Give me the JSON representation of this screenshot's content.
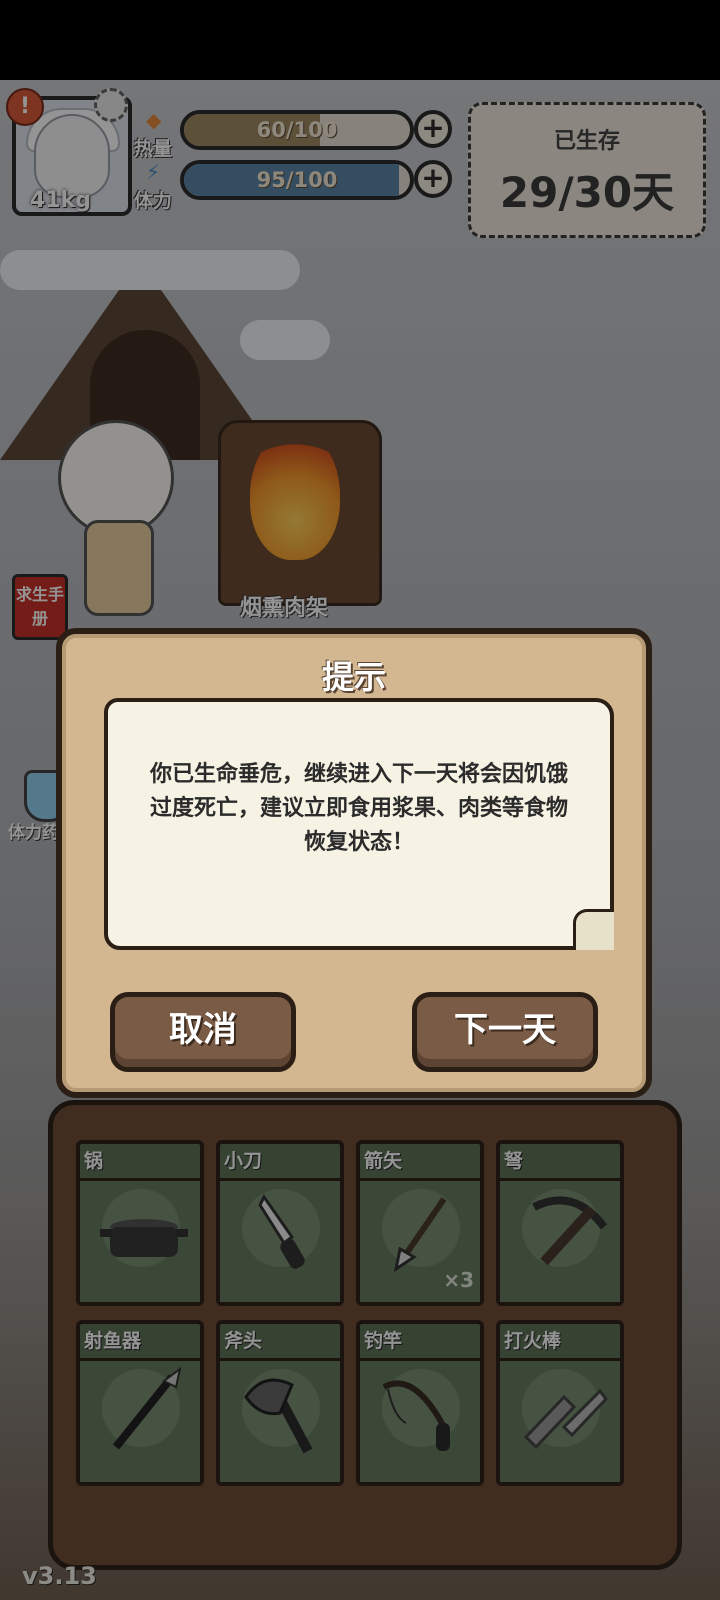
{
  "hud": {
    "weight": "41kg",
    "alert": "!",
    "heat": {
      "label": "热量",
      "value": "60/100",
      "ratio": 0.6,
      "color": "#9f8a63"
    },
    "stamina": {
      "label": "体力",
      "value": "95/100",
      "ratio": 0.95,
      "color": "#5b86a8"
    },
    "survive_label": "已生存",
    "survive_days": "29/30天"
  },
  "scene": {
    "rack_label": "烟熏肉架",
    "guide_label": "求生手册",
    "potion_label": "体力药"
  },
  "dialog": {
    "title": "提示",
    "message_lines": [
      "你已生命垂危，继续进入下一天将会因饥饿",
      "过度死亡，建议立即食用浆果、肉类等食物",
      "恢复状态！"
    ],
    "cancel_label": "取消",
    "next_label": "下一天"
  },
  "inventory": [
    {
      "name": "锅",
      "icon": "pot-icon"
    },
    {
      "name": "小刀",
      "icon": "knife-icon"
    },
    {
      "name": "箭矢",
      "icon": "arrow-icon",
      "count": "×3"
    },
    {
      "name": "弩",
      "icon": "crossbow-icon"
    },
    {
      "name": "射鱼器",
      "icon": "fish-spear-icon"
    },
    {
      "name": "斧头",
      "icon": "axe-icon"
    },
    {
      "name": "钓竿",
      "icon": "fishing-rod-icon"
    },
    {
      "name": "打火棒",
      "icon": "fire-starter-icon"
    }
  ],
  "version": "v3.13",
  "colors": {
    "wood": "#d2b791",
    "paper": "#f6f3e4",
    "slot": "#5d7257"
  }
}
